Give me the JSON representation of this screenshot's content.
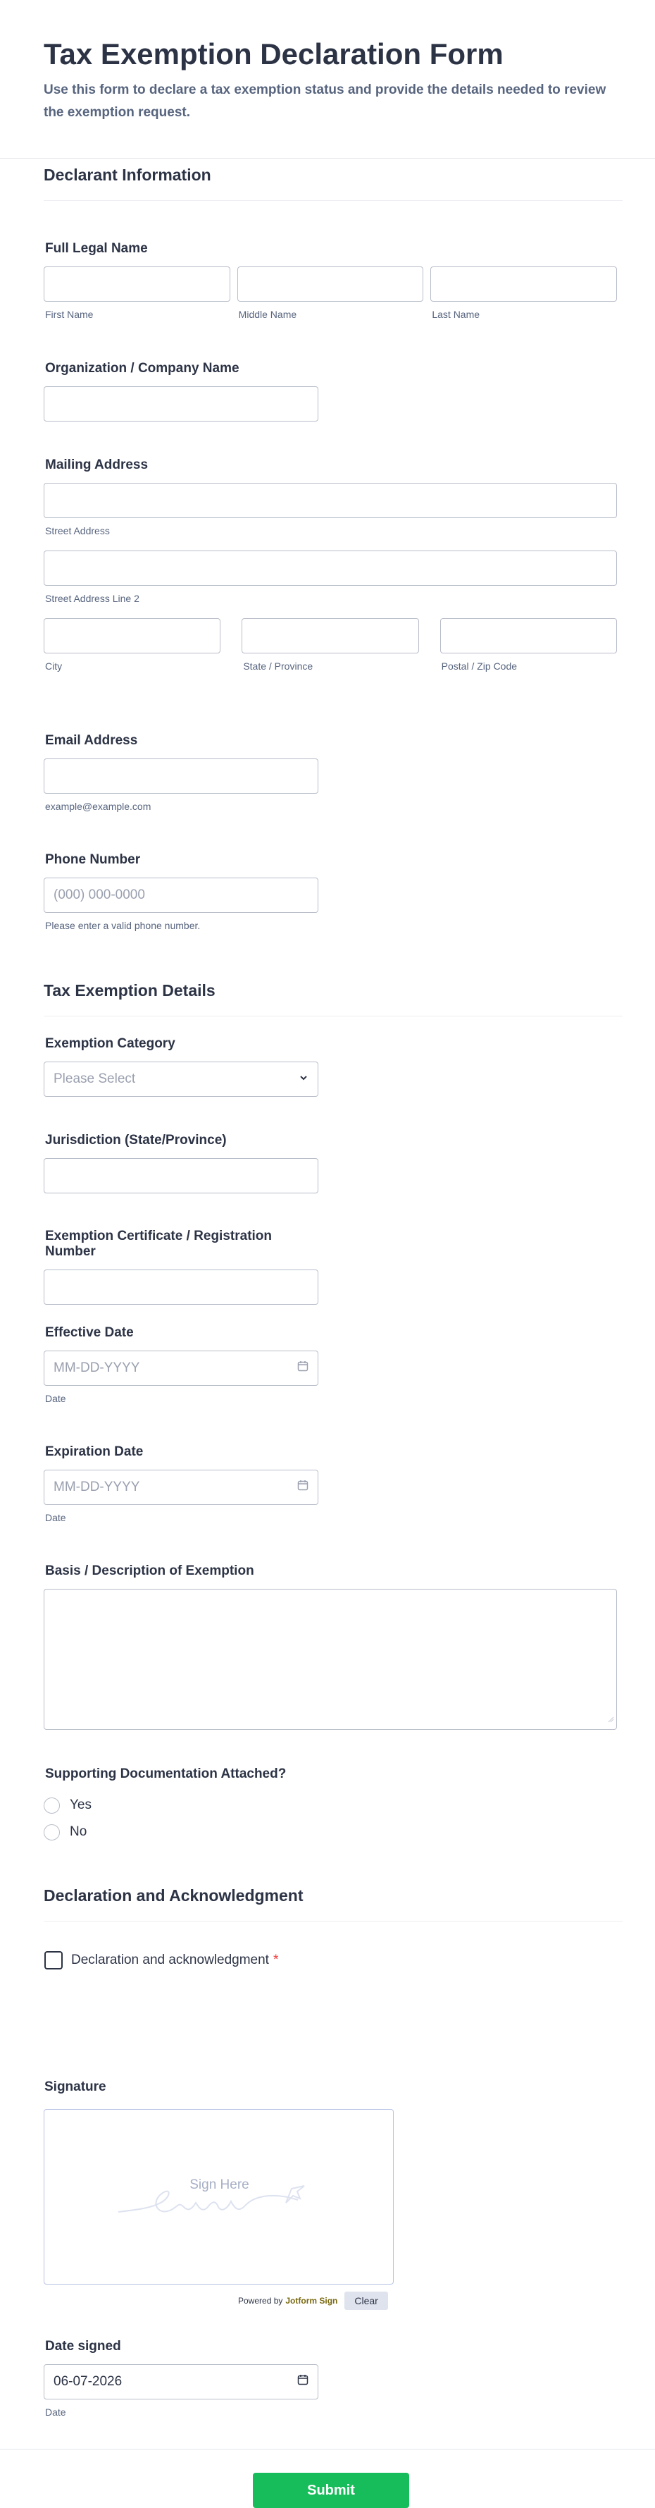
{
  "header": {
    "title": "Tax Exemption Declaration Form",
    "subtitle": "Use this form to declare a tax exemption status and provide the details needed to review the exemption request."
  },
  "sections": {
    "declarant": "Declarant Information",
    "tax": "Tax Exemption Details",
    "declaration": "Declaration and Acknowledgment"
  },
  "fields": {
    "full_name": {
      "label": "Full Legal Name",
      "first": "First Name",
      "middle": "Middle Name",
      "last": "Last Name"
    },
    "organization": {
      "label": "Organization / Company Name"
    },
    "mailing": {
      "label": "Mailing Address",
      "street": "Street Address",
      "street2": "Street Address Line 2",
      "city": "City",
      "state": "State / Province",
      "postal": "Postal / Zip Code"
    },
    "email": {
      "label": "Email Address",
      "sub": "example@example.com"
    },
    "phone": {
      "label": "Phone Number",
      "placeholder": "(000) 000-0000",
      "sub": "Please enter a valid phone number."
    },
    "category": {
      "label": "Exemption Category",
      "placeholder": "Please Select"
    },
    "jurisdiction": {
      "label": "Jurisdiction (State/Province)"
    },
    "certificate": {
      "label": "Exemption Certificate / Registration Number"
    },
    "effective": {
      "label": "Effective Date",
      "placeholder": "MM-DD-YYYY",
      "sub": "Date"
    },
    "expiration": {
      "label": "Expiration Date",
      "placeholder": "MM-DD-YYYY",
      "sub": "Date"
    },
    "basis": {
      "label": "Basis / Description of Exemption"
    },
    "docs": {
      "label": "Supporting Documentation Attached?",
      "options": [
        "Yes",
        "No"
      ]
    },
    "acknowledge": {
      "label": "Declaration and acknowledgment",
      "required": "*"
    },
    "signature": {
      "label": "Signature",
      "hint": "Sign Here",
      "powered": "Powered by",
      "brand": "Jotform Sign",
      "clear": "Clear"
    },
    "date_signed": {
      "label": "Date signed",
      "value": "06-07-2026",
      "sub": "Date"
    }
  },
  "submit": "Submit",
  "colors": {
    "accent": "#18bd5b",
    "required": "#f23a3c",
    "text": "#2c3345"
  }
}
